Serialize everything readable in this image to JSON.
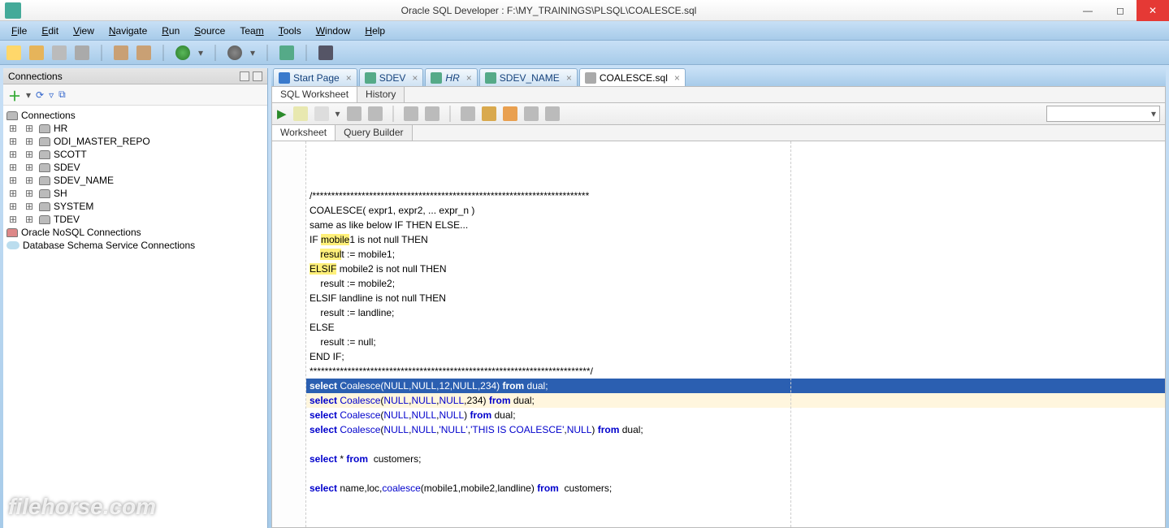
{
  "window": {
    "title": "Oracle SQL Developer : F:\\MY_TRAININGS\\PLSQL\\COALESCE.sql"
  },
  "menu": [
    "File",
    "Edit",
    "View",
    "Navigate",
    "Run",
    "Source",
    "Team",
    "Tools",
    "Window",
    "Help"
  ],
  "connections_panel": {
    "title": "Connections",
    "root": "Connections",
    "items": [
      "HR",
      "ODI_MASTER_REPO",
      "SCOTT",
      "SDEV",
      "SDEV_NAME",
      "SH",
      "SYSTEM",
      "TDEV"
    ],
    "nosql": "Oracle NoSQL Connections",
    "cloud": "Database Schema Service Connections"
  },
  "tabs": [
    {
      "label": "Start Page",
      "icon": "question-icon",
      "active": false
    },
    {
      "label": "SDEV",
      "icon": "sql-icon",
      "active": false
    },
    {
      "label": "HR",
      "icon": "sql-icon",
      "italic": true,
      "active": false
    },
    {
      "label": "SDEV_NAME",
      "icon": "sql-icon",
      "active": false
    },
    {
      "label": "COALESCE.sql",
      "icon": "file-icon",
      "active": true
    }
  ],
  "subtabs": {
    "worksheet": "SQL Worksheet",
    "history": "History"
  },
  "ws_tabs": {
    "worksheet": "Worksheet",
    "querybuilder": "Query Builder"
  },
  "code_lines": [
    {
      "html": "/*************************************************************************"
    },
    {
      "html": "COALESCE( expr1, expr2, ... expr_n )"
    },
    {
      "html": "same as like below IF THEN ELSE..."
    },
    {
      "html": "IF <span class='hl-yellow'>mobile</span>1 is not null THEN"
    },
    {
      "html": "    <span class='hl-yellow'>resul</span>t := mobile1;"
    },
    {
      "html": "<span class='hl-yellow'>ELSIF</span> mobile2 is not null THEN"
    },
    {
      "html": "    result := mobile2;"
    },
    {
      "html": "ELSIF landline is not null THEN"
    },
    {
      "html": "    result := landline;"
    },
    {
      "html": "ELSE"
    },
    {
      "html": "    result := null;"
    },
    {
      "html": "END IF;"
    },
    {
      "html": "**************************************************************************/"
    },
    {
      "cls": "hl-sel",
      "html": "<span class='kw'>select</span> <span class='func'>Coalesce</span>(<span class='lit'>NULL</span>,<span class='lit'>NULL</span>,12,<span class='lit'>NULL</span>,234) <span class='kw'>from</span> dual;"
    },
    {
      "cls": "hl-line",
      "html": "<span class='kw'>select</span> <span class='func'>Coalesce</span>(<span class='lit'>NULL</span>,<span class='lit'>NULL</span>,<span class='lit'>NULL</span>,234) <span class='kw'>from</span> dual;"
    },
    {
      "html": "<span class='kw'>select</span> <span class='func'>Coalesce</span>(<span class='lit'>NULL</span>,<span class='lit'>NULL</span>,<span class='lit'>NULL</span>) <span class='kw'>from</span> dual;"
    },
    {
      "html": "<span class='kw'>select</span> <span class='func'>Coalesce</span>(<span class='lit'>NULL</span>,<span class='lit'>NULL</span>,<span class='str'>'NULL'</span>,<span class='str'>'THIS IS COALESCE'</span>,<span class='lit'>NULL</span>) <span class='kw'>from</span> dual;"
    },
    {
      "html": ""
    },
    {
      "html": "<span class='kw'>select</span> * <span class='kw'>from</span>  customers;"
    },
    {
      "html": ""
    },
    {
      "html": "<span class='kw'>select</span> name,loc,<span class='func'>coalesce</span>(mobile1,mobile2,landline) <span class='kw'>from</span>  customers;"
    }
  ],
  "watermark": "filehorse.com"
}
